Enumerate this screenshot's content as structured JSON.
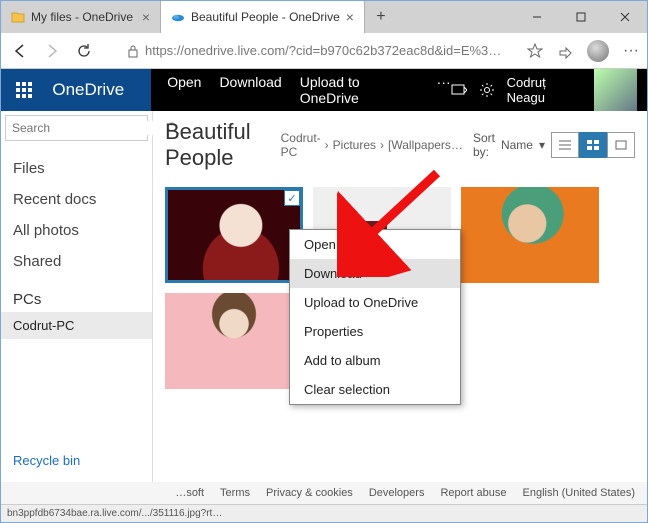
{
  "window": {
    "tabs": [
      {
        "title": "My files - OneDrive",
        "active": false
      },
      {
        "title": "Beautiful People - OneDrive",
        "active": true
      }
    ]
  },
  "address": {
    "url": "https://onedrive.live.com/?cid=b970c62b372eac8d&id=E%3…"
  },
  "header": {
    "brand": "OneDrive",
    "commands": {
      "open": "Open",
      "download": "Download",
      "upload": "Upload to OneDrive",
      "more": "···"
    },
    "username": "Codruț Neagu"
  },
  "sidebar": {
    "search_placeholder": "Search",
    "items": [
      "Files",
      "Recent docs",
      "All photos",
      "Shared"
    ],
    "pcs_label": "PCs",
    "pcs": [
      "Codrut-PC"
    ],
    "recycle": "Recycle bin"
  },
  "main": {
    "title": "Beautiful People",
    "breadcrumb": [
      "Codrut-PC",
      "Pictures",
      "[Wallpapers…"
    ],
    "sort_label": "Sort by:",
    "sort_value": "Name"
  },
  "context_menu": {
    "items": [
      "Open",
      "Download",
      "Upload to OneDrive",
      "Properties",
      "Add to album",
      "Clear selection"
    ],
    "highlighted_index": 1
  },
  "footer": {
    "items": [
      "…soft",
      "Terms",
      "Privacy & cookies",
      "Developers",
      "Report abuse",
      "English (United States)"
    ]
  },
  "status": {
    "text": "bn3ppfdb6734bae.ra.live.com/.../351116.jpg?rt…"
  }
}
